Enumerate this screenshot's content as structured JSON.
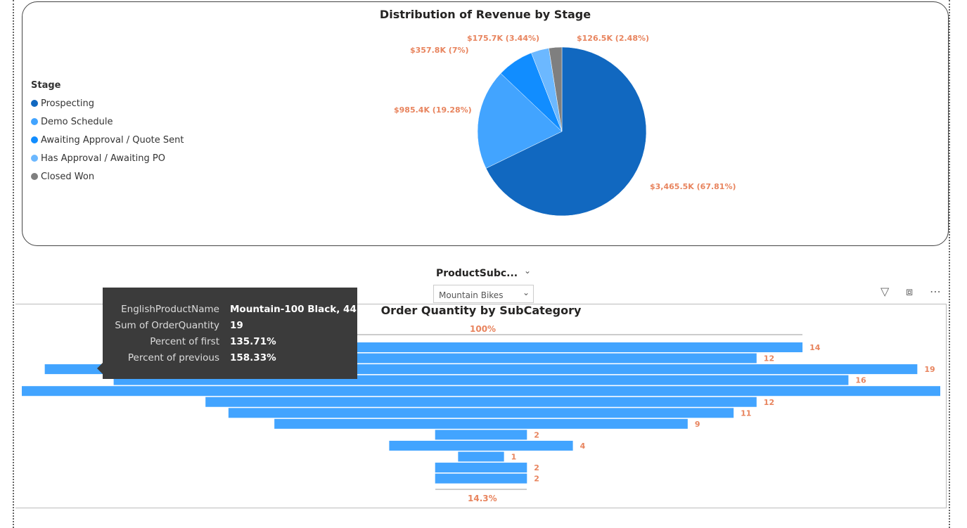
{
  "pie_card": {
    "title": "Distribution of Revenue by Stage",
    "legend_title": "Stage"
  },
  "slicer": {
    "title": "ProductSubc...",
    "selected": "Mountain Bikes"
  },
  "funnel_card": {
    "title": "Order Quantity by SubCategory",
    "top_pct_label": "100%",
    "bottom_pct_label": "14.3%"
  },
  "tooltip": {
    "rows": [
      {
        "key": "EnglishProductName",
        "value": "Mountain-100 Black, 44"
      },
      {
        "key": "Sum of OrderQuantity",
        "value": "19"
      },
      {
        "key": "Percent of first",
        "value": "135.71%"
      },
      {
        "key": "Percent of previous",
        "value": "158.33%"
      }
    ]
  },
  "icons": [
    "filter-icon",
    "focus-mode-icon",
    "more-options-icon"
  ],
  "chart_data": [
    {
      "type": "pie",
      "title": "Distribution of Revenue by Stage",
      "legend_title": "Stage",
      "legend_placement": "left",
      "slices": [
        {
          "name": "Prospecting",
          "value": 3465.5,
          "label": "$3,465.5K (67.81%)",
          "color": "#1168C0"
        },
        {
          "name": "Demo Schedule",
          "value": 985.4,
          "label": "$985.4K (19.28%)",
          "color": "#42A4FF"
        },
        {
          "name": "Awaiting Approval / Quote Sent",
          "value": 357.8,
          "label": "$357.8K (7%)",
          "color": "#118DFF"
        },
        {
          "name": "Has Approval / Awaiting PO",
          "value": 175.7,
          "label": "$175.7K (3.44%)",
          "color": "#6CB8FF"
        },
        {
          "name": "Closed Won",
          "value": 126.5,
          "label": "$126.5K (2.48%)",
          "color": "#7F7F7F"
        }
      ]
    },
    {
      "type": "bar",
      "subtype": "funnel",
      "title": "Order Quantity by SubCategory",
      "values": [
        14,
        12,
        19,
        16,
        20,
        12,
        11,
        9,
        2,
        4,
        1,
        2,
        2
      ],
      "labels": [
        "14",
        "12",
        "19",
        "16",
        "",
        "12",
        "11",
        "9",
        "2",
        "4",
        "1",
        "2",
        "2"
      ],
      "color": "#42A4FF",
      "label_color": "#E8845E"
    }
  ]
}
